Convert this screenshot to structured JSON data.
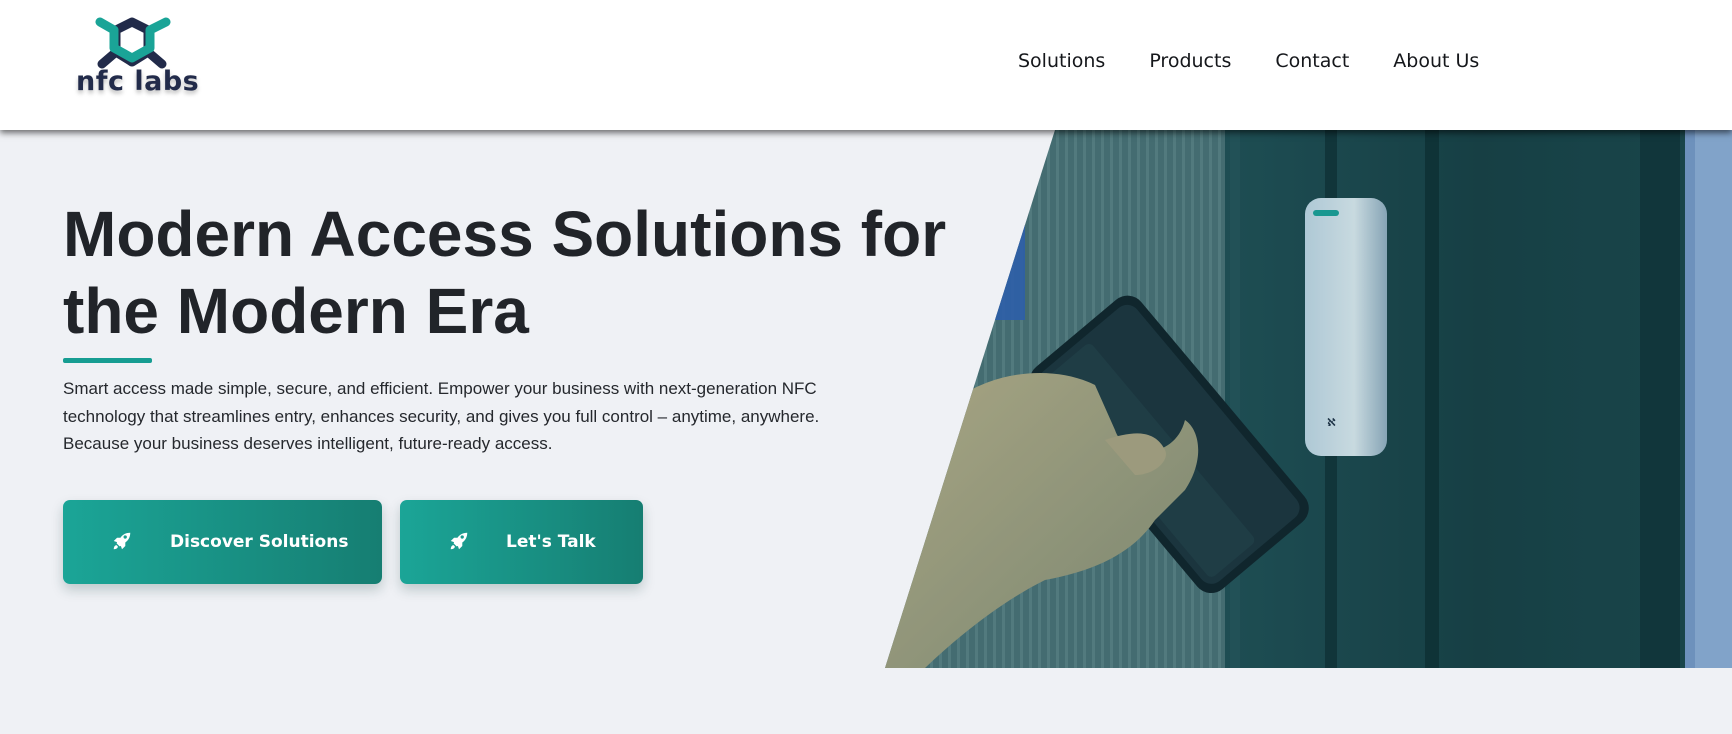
{
  "brand": {
    "logo_text": "nfc labs",
    "accent_color": "#169d92",
    "logo_dark_color": "#222b4a"
  },
  "nav": {
    "items": [
      {
        "label": "Solutions"
      },
      {
        "label": "Products"
      },
      {
        "label": "Contact"
      },
      {
        "label": "About Us"
      }
    ]
  },
  "hero": {
    "title": "Modern Access Solutions for the Modern Era",
    "description": "Smart access made simple, secure, and efficient. Empower your business with next-generation NFC technology that streamlines entry, enhances security, and gives you full control – anytime, anywhere. Because your business deserves intelligent, future-ready access.",
    "buttons": {
      "discover_label": "Discover Solutions",
      "talk_label": "Let's Talk",
      "icon": "rocket-icon",
      "gradient_start": "#1ba597",
      "gradient_end": "#167e72"
    },
    "image": {
      "subject": "hand-tapping-phone-on-nfc-reader"
    }
  }
}
